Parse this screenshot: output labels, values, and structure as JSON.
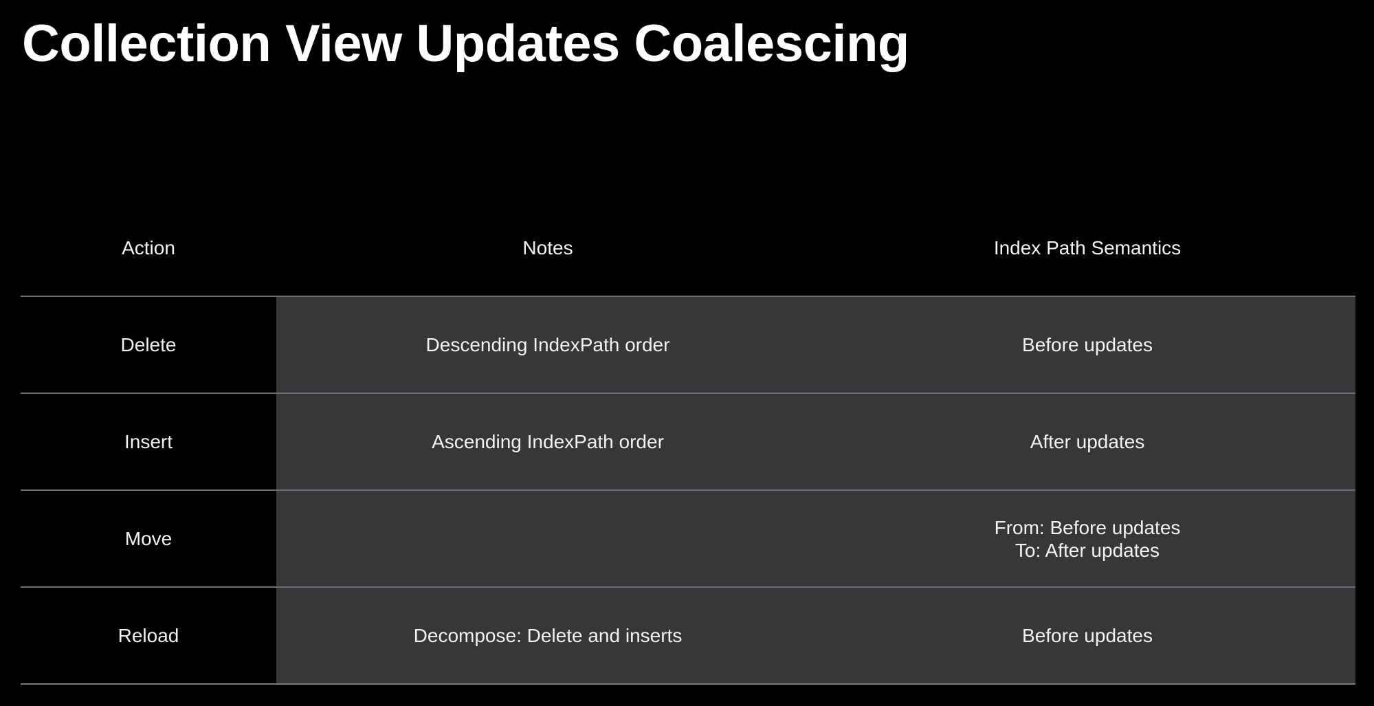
{
  "title": "Collection View Updates Coalescing",
  "table": {
    "headers": [
      "Action",
      "Notes",
      "Index Path Semantics"
    ],
    "rows": [
      {
        "action": "Delete",
        "notes": "Descending IndexPath order",
        "semantics": [
          "Before updates"
        ]
      },
      {
        "action": "Insert",
        "notes": "Ascending IndexPath order",
        "semantics": [
          "After updates"
        ]
      },
      {
        "action": "Move",
        "notes": "",
        "semantics": [
          "From: Before updates",
          "To: After updates"
        ]
      },
      {
        "action": "Reload",
        "notes": "Decompose: Delete and inserts",
        "semantics": [
          "Before updates"
        ]
      }
    ]
  },
  "colors": {
    "background": "#000000",
    "cell_fill": "#363739",
    "divider": "#6e6e72",
    "text": "#ffffff"
  }
}
